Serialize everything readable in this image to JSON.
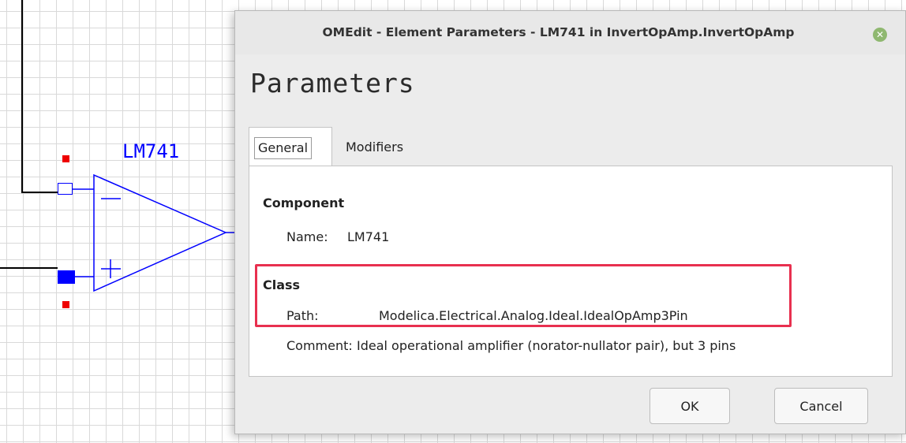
{
  "diagram": {
    "component_label": "LM741",
    "minus_sign": "−",
    "plus_sign": "+"
  },
  "dialog": {
    "title": "OMEdit - Element Parameters - LM741 in InvertOpAmp.InvertOpAmp",
    "heading": "Parameters",
    "close_icon": "close-icon",
    "tabs": [
      {
        "label": "General",
        "active": true
      },
      {
        "label": "Modifiers",
        "active": false
      }
    ],
    "component": {
      "section_title": "Component",
      "name_label": "Name:",
      "name_value": "LM741"
    },
    "class": {
      "section_title": "Class",
      "path_label": "Path:",
      "path_value": "Modelica.Electrical.Analog.Ideal.IdealOpAmp3Pin",
      "comment_label": "Comment:",
      "comment_value": "Ideal operational amplifier (norator-nullator pair), but 3 pins"
    },
    "buttons": {
      "ok": "OK",
      "cancel": "Cancel"
    },
    "colors": {
      "highlight": "#e8304f",
      "diagram_blue": "#0000ff",
      "handle_red": "#ee0000",
      "close_green": "#8fb870"
    }
  }
}
